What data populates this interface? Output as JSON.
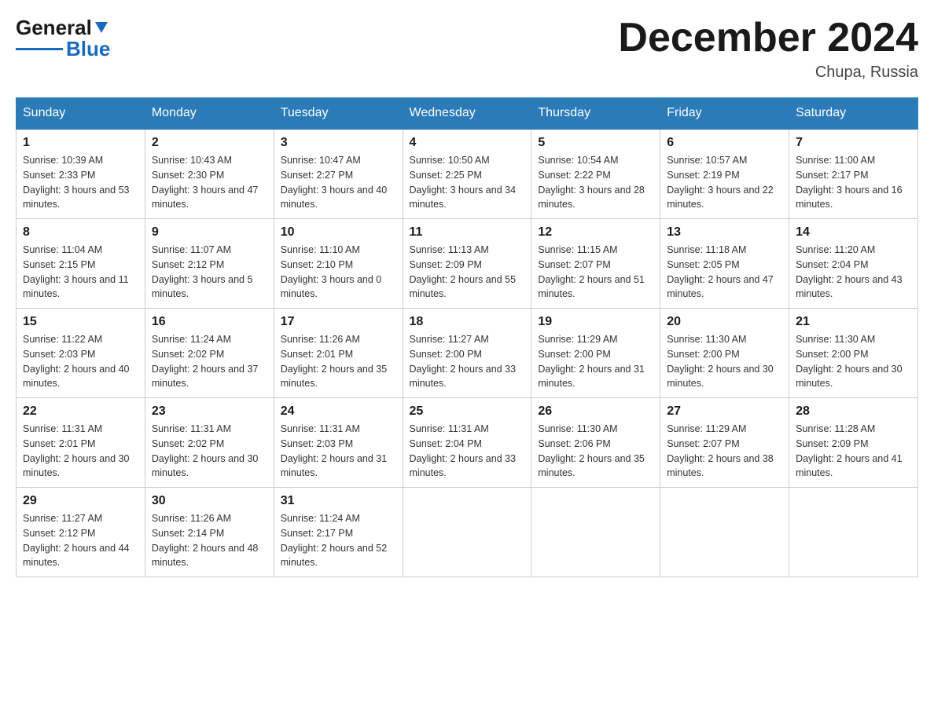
{
  "header": {
    "logo_general": "General",
    "logo_blue": "Blue",
    "month_title": "December 2024",
    "location": "Chupa, Russia"
  },
  "days_of_week": [
    "Sunday",
    "Monday",
    "Tuesday",
    "Wednesday",
    "Thursday",
    "Friday",
    "Saturday"
  ],
  "weeks": [
    [
      {
        "day": "1",
        "sunrise": "10:39 AM",
        "sunset": "2:33 PM",
        "daylight": "3 hours and 53 minutes."
      },
      {
        "day": "2",
        "sunrise": "10:43 AM",
        "sunset": "2:30 PM",
        "daylight": "3 hours and 47 minutes."
      },
      {
        "day": "3",
        "sunrise": "10:47 AM",
        "sunset": "2:27 PM",
        "daylight": "3 hours and 40 minutes."
      },
      {
        "day": "4",
        "sunrise": "10:50 AM",
        "sunset": "2:25 PM",
        "daylight": "3 hours and 34 minutes."
      },
      {
        "day": "5",
        "sunrise": "10:54 AM",
        "sunset": "2:22 PM",
        "daylight": "3 hours and 28 minutes."
      },
      {
        "day": "6",
        "sunrise": "10:57 AM",
        "sunset": "2:19 PM",
        "daylight": "3 hours and 22 minutes."
      },
      {
        "day": "7",
        "sunrise": "11:00 AM",
        "sunset": "2:17 PM",
        "daylight": "3 hours and 16 minutes."
      }
    ],
    [
      {
        "day": "8",
        "sunrise": "11:04 AM",
        "sunset": "2:15 PM",
        "daylight": "3 hours and 11 minutes."
      },
      {
        "day": "9",
        "sunrise": "11:07 AM",
        "sunset": "2:12 PM",
        "daylight": "3 hours and 5 minutes."
      },
      {
        "day": "10",
        "sunrise": "11:10 AM",
        "sunset": "2:10 PM",
        "daylight": "3 hours and 0 minutes."
      },
      {
        "day": "11",
        "sunrise": "11:13 AM",
        "sunset": "2:09 PM",
        "daylight": "2 hours and 55 minutes."
      },
      {
        "day": "12",
        "sunrise": "11:15 AM",
        "sunset": "2:07 PM",
        "daylight": "2 hours and 51 minutes."
      },
      {
        "day": "13",
        "sunrise": "11:18 AM",
        "sunset": "2:05 PM",
        "daylight": "2 hours and 47 minutes."
      },
      {
        "day": "14",
        "sunrise": "11:20 AM",
        "sunset": "2:04 PM",
        "daylight": "2 hours and 43 minutes."
      }
    ],
    [
      {
        "day": "15",
        "sunrise": "11:22 AM",
        "sunset": "2:03 PM",
        "daylight": "2 hours and 40 minutes."
      },
      {
        "day": "16",
        "sunrise": "11:24 AM",
        "sunset": "2:02 PM",
        "daylight": "2 hours and 37 minutes."
      },
      {
        "day": "17",
        "sunrise": "11:26 AM",
        "sunset": "2:01 PM",
        "daylight": "2 hours and 35 minutes."
      },
      {
        "day": "18",
        "sunrise": "11:27 AM",
        "sunset": "2:00 PM",
        "daylight": "2 hours and 33 minutes."
      },
      {
        "day": "19",
        "sunrise": "11:29 AM",
        "sunset": "2:00 PM",
        "daylight": "2 hours and 31 minutes."
      },
      {
        "day": "20",
        "sunrise": "11:30 AM",
        "sunset": "2:00 PM",
        "daylight": "2 hours and 30 minutes."
      },
      {
        "day": "21",
        "sunrise": "11:30 AM",
        "sunset": "2:00 PM",
        "daylight": "2 hours and 30 minutes."
      }
    ],
    [
      {
        "day": "22",
        "sunrise": "11:31 AM",
        "sunset": "2:01 PM",
        "daylight": "2 hours and 30 minutes."
      },
      {
        "day": "23",
        "sunrise": "11:31 AM",
        "sunset": "2:02 PM",
        "daylight": "2 hours and 30 minutes."
      },
      {
        "day": "24",
        "sunrise": "11:31 AM",
        "sunset": "2:03 PM",
        "daylight": "2 hours and 31 minutes."
      },
      {
        "day": "25",
        "sunrise": "11:31 AM",
        "sunset": "2:04 PM",
        "daylight": "2 hours and 33 minutes."
      },
      {
        "day": "26",
        "sunrise": "11:30 AM",
        "sunset": "2:06 PM",
        "daylight": "2 hours and 35 minutes."
      },
      {
        "day": "27",
        "sunrise": "11:29 AM",
        "sunset": "2:07 PM",
        "daylight": "2 hours and 38 minutes."
      },
      {
        "day": "28",
        "sunrise": "11:28 AM",
        "sunset": "2:09 PM",
        "daylight": "2 hours and 41 minutes."
      }
    ],
    [
      {
        "day": "29",
        "sunrise": "11:27 AM",
        "sunset": "2:12 PM",
        "daylight": "2 hours and 44 minutes."
      },
      {
        "day": "30",
        "sunrise": "11:26 AM",
        "sunset": "2:14 PM",
        "daylight": "2 hours and 48 minutes."
      },
      {
        "day": "31",
        "sunrise": "11:24 AM",
        "sunset": "2:17 PM",
        "daylight": "2 hours and 52 minutes."
      },
      null,
      null,
      null,
      null
    ]
  ],
  "labels": {
    "sunrise": "Sunrise:",
    "sunset": "Sunset:",
    "daylight": "Daylight:"
  }
}
